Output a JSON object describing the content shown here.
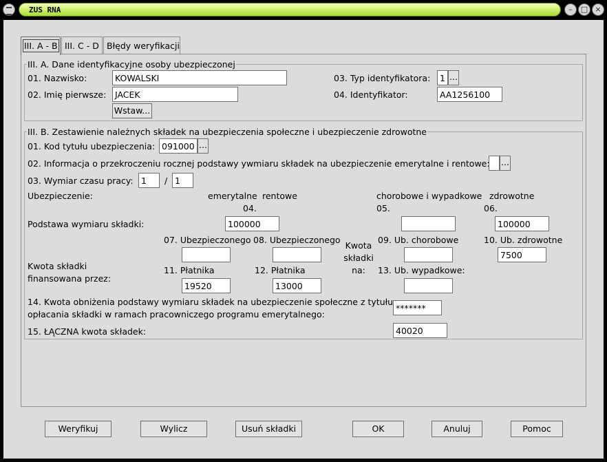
{
  "window": {
    "title": "ZUS RNA",
    "minimize": "–",
    "maximize": "□",
    "close": "×"
  },
  "tabs": [
    {
      "label": "III. A - B",
      "active": true
    },
    {
      "label": "III. C - D",
      "active": false
    },
    {
      "label": "Błędy weryfikacji",
      "active": false
    }
  ],
  "sectionA": {
    "legend": "III. A. Dane identyfikacyjne osoby ubezpieczonej",
    "surname_label": "01. Nazwisko:",
    "surname_value": "KOWALSKI",
    "firstname_label": "02. Imię pierwsze:",
    "firstname_value": "JACEK",
    "insert_button": "Wstaw...",
    "idtype_label": "03. Typ identyfikatora:",
    "idtype_value": "1",
    "id_label": "04. Identyfikator:",
    "id_value": "AA1256100",
    "ellipsis": "..."
  },
  "sectionB": {
    "legend": "III. B. Zestawienie należnych składek na ubezpieczenia społeczne i ubezpieczenie zdrowotne",
    "code_label": "01. Kod tytułu ubezpieczenia:",
    "code_value": "091000",
    "exceed_label": "02. Informacja o przekroczeniu rocznej podstawy ywmiaru składek na ubezpieczenie emerytalne i rentowe:",
    "exceed_value": "",
    "worktime_label": "03. Wymiar czasu pracy:",
    "worktime_num": "1",
    "worktime_sep": "/",
    "worktime_den": "1",
    "insurance_label": "Ubezpieczenie:",
    "col_pension": "emerytalne",
    "col_disability": "rentowe",
    "col_sickness_accident": "chorobowe i wypadkowe",
    "col_health": "zdrowotne",
    "num_04": "04.",
    "num_05": "05.",
    "num_06": "06.",
    "base_label": "Podstawa wymiaru składki:",
    "base_04": "100000",
    "base_05": "",
    "base_06": "100000",
    "f07_label": "07. Ubezpieczonego",
    "f07_value": "",
    "f08_label": "08. Ubezpieczonego",
    "f08_value": "",
    "kwota_label_1": "Kwota",
    "kwota_label_2": "składki",
    "kwota_label_3": "na:",
    "f09_label": "09. Ub. chorobowe",
    "f09_value": "",
    "f10_label": "10. Ub. zdrowotne",
    "f10_value": "7500",
    "financed_label_1": "Kwota składki",
    "financed_label_2": "finansowana przez:",
    "f11_label": "11. Płatnika",
    "f11_value": "19520",
    "f12_label": "12. Płatnika",
    "f12_value": "13000",
    "f13_label": "13. Ub. wypadkowe:",
    "f13_value": "",
    "f14_label_1": "14. Kwota obniżenia podstawy wymiaru składek na ubezpieczenie społeczne z tytułu",
    "f14_label_2": "opłacania składki w ramach pracowniczego programu emerytalnego:",
    "f14_value": "*******",
    "f15_label": "15. ŁĄCZNA kwota składek:",
    "f15_value": "40020"
  },
  "buttons": {
    "verify": "Weryfikuj",
    "calculate": "Wylicz",
    "remove": "Usuń składki",
    "ok": "OK",
    "cancel": "Anuluj",
    "help": "Pomoc"
  },
  "colors": {
    "title_accent": "#cdf06a",
    "frame": "#000000",
    "dialog_bg": "#dcdcdc"
  }
}
